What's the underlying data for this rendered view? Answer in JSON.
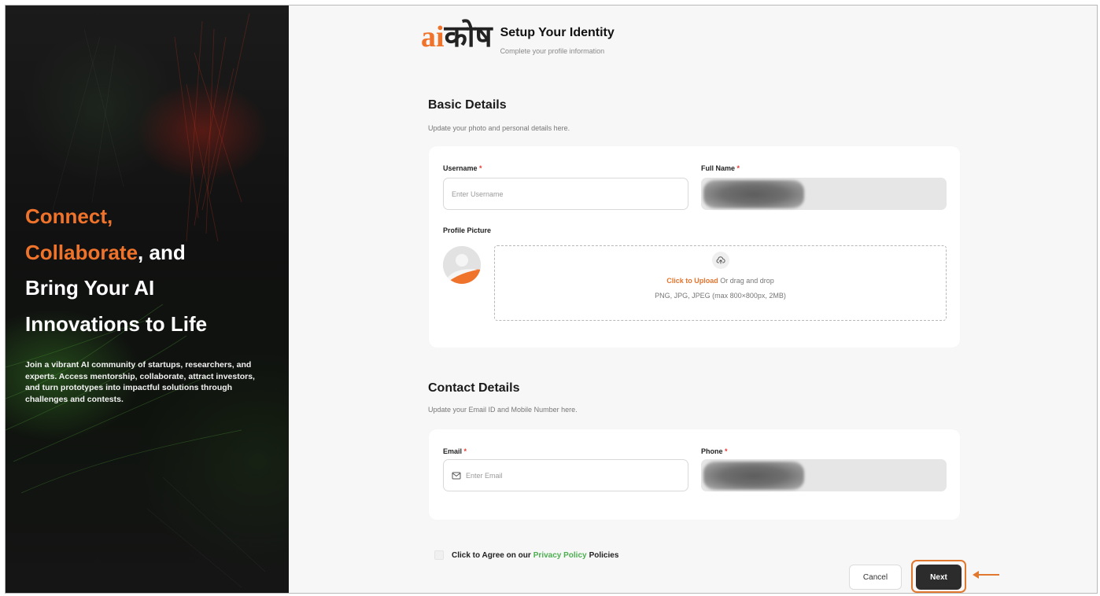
{
  "hero": {
    "title_accent_1": "Connect,",
    "title_accent_2": "Collaborate",
    "title_rest_2": ", and",
    "title_line_3": "Bring Your AI",
    "title_line_4": "Innovations to Life",
    "description": "Join a vibrant AI community of startups, researchers, and experts. Access mentorship, collaborate, attract investors, and turn prototypes into impactful solutions through challenges and contests."
  },
  "brand": {
    "logo_ai": "ai",
    "logo_kosh": "कोष",
    "title": "Setup Your Identity",
    "subtitle": "Complete your profile information"
  },
  "basic": {
    "title": "Basic Details",
    "subtitle": "Update your photo and personal details here.",
    "username_label": "Username",
    "username_placeholder": "Enter Username",
    "fullname_label": "Full Name",
    "profile_label": "Profile Picture",
    "upload_link": "Click to Upload",
    "upload_rest": "Or drag and drop",
    "upload_formats": "PNG, JPG, JPEG (max 800×800px, 2MB)"
  },
  "contact": {
    "title": "Contact Details",
    "subtitle": "Update your Email ID and Mobile Number here.",
    "email_label": "Email",
    "email_placeholder": "Enter Email",
    "phone_label": "Phone"
  },
  "required_mark": "*",
  "agree": {
    "prefix": "Click to Agree on our",
    "link": "Privacy Policy",
    "suffix": "Policies"
  },
  "buttons": {
    "cancel": "Cancel",
    "next": "Next"
  },
  "colors": {
    "accent": "#f0732b",
    "link_green": "#4caf50",
    "required": "#e53935",
    "button_dark": "#2c2c2c",
    "highlight": "#e0792f"
  }
}
